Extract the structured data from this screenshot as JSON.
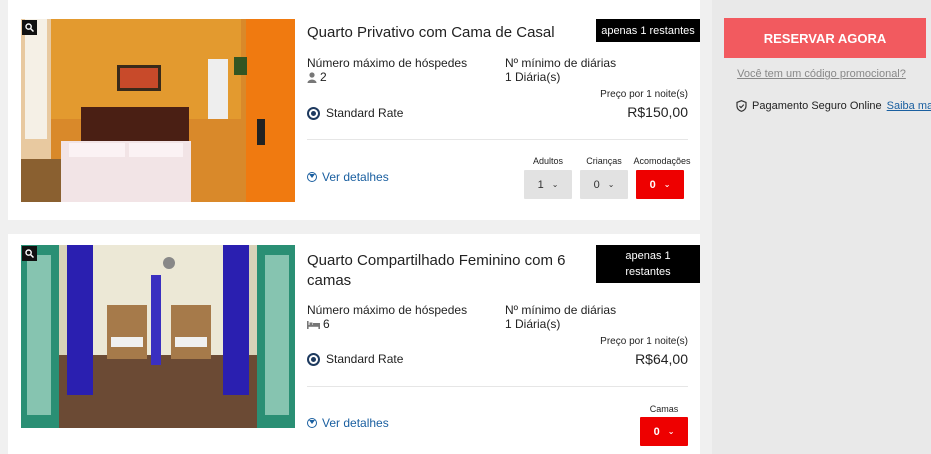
{
  "rooms": [
    {
      "title": "Quarto Privativo com Cama de Casal",
      "availability": "apenas 1 restantes",
      "max_guests_label": "Número máximo de hóspedes",
      "max_guests_value": "2",
      "guest_icon": "person-icon",
      "min_nights_label": "Nº mínimo de diárias",
      "min_nights_value": "1 Diária(s)",
      "price_label": "Preço por 1 noite(s)",
      "price": "R$150,00",
      "rate_name": "Standard Rate",
      "details_label": "Ver detalhes",
      "selectors": [
        {
          "label": "Adultos",
          "value": "1"
        },
        {
          "label": "Crianças",
          "value": "0"
        },
        {
          "label": "Acomodações",
          "value": "0"
        }
      ]
    },
    {
      "title": "Quarto Compartilhado Feminino com 6 camas",
      "availability": "apenas 1 restantes",
      "max_guests_label": "Número máximo de hóspedes",
      "max_guests_value": "6",
      "guest_icon": "bed-icon",
      "min_nights_label": "Nº mínimo de diárias",
      "min_nights_value": "1 Diária(s)",
      "price_label": "Preço por 1 noite(s)",
      "price": "R$64,00",
      "rate_name": "Standard Rate",
      "details_label": "Ver detalhes",
      "selectors": [
        {
          "label": "Camas",
          "value": "0"
        }
      ]
    }
  ],
  "sidebar": {
    "book_button": "RESERVAR AGORA",
    "promo_link": "Você tem um código promocional?",
    "secure_text": "Pagamento Seguro Online",
    "learn_more": "Saiba mais"
  },
  "colors": {
    "book_button": "#f25a5f",
    "accommodation_select": "#ee0000",
    "link": "#1a5fa0",
    "badge": "#000000"
  }
}
